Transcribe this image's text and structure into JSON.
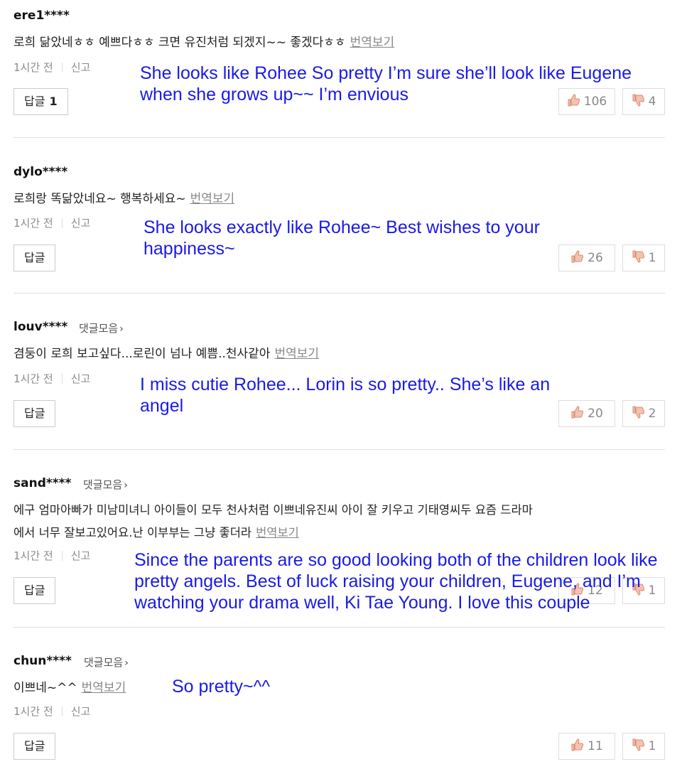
{
  "comments": [
    {
      "user": "ere1****",
      "text": "로희 닮았네ㅎㅎ 예쁘다ㅎㅎ 크면 유진처럼 되겠지~~ 좋겠다ㅎㅎ",
      "translate": "번역보기",
      "time": "1시간 전",
      "report": "신고",
      "reply": "답글",
      "reply_count": "1",
      "likes": "106",
      "dislikes": "4",
      "translation": "She looks like Rohee So pretty I’m sure she’ll look like Eugene when she grows up~~ I’m envious"
    },
    {
      "user": "dylo****",
      "text": "로희랑 똑닮았네요~ 행복하세요~",
      "translate": "번역보기",
      "time": "1시간 전",
      "report": "신고",
      "reply": "답글",
      "likes": "26",
      "dislikes": "1",
      "translation": "She looks exactly like Rohee~ Best wishes to your happiness~"
    },
    {
      "user": "louv****",
      "collect": "댓글모음",
      "text": "겸둥이 로희 보고싶다...로린이 넘나 예쁨..천사같아",
      "translate": "번역보기",
      "time": "1시간 전",
      "report": "신고",
      "reply": "답글",
      "likes": "20",
      "dislikes": "2",
      "translation": "I miss cutie Rohee... Lorin is so pretty.. She’s like an angel"
    },
    {
      "user": "sand****",
      "collect": "댓글모음",
      "text_line1": "에구 엄마아빠가 미남미녀니 아이들이 모두 천사처럼 이쁘네유진씨 아이 잘 키우고 기태영씨두 요즘 드라마",
      "text_line2": "에서 너무 잘보고있어요.난 이부부는 그냥 좋더라",
      "translate": "번역보기",
      "time": "1시간 전",
      "report": "신고",
      "reply": "답글",
      "likes": "12",
      "dislikes": "1",
      "translation": "Since the parents are so good looking both of the children look like pretty angels. Best of luck raising your children, Eugene, and I’m watching your drama well, Ki Tae Young. I love this couple"
    },
    {
      "user": "chun****",
      "collect": "댓글모음",
      "text": "이쁘네~^^",
      "translate": "번역보기",
      "time": "1시간 전",
      "report": "신고",
      "reply": "답글",
      "likes": "11",
      "dislikes": "1",
      "translation": "So pretty~^^"
    }
  ],
  "colors": {
    "translation": "#1a1ae6",
    "thumb_up": "#e8a08a",
    "thumb_down": "#e8a08a"
  },
  "icons": {
    "like": "thumbs-up-icon",
    "dislike": "thumbs-down-icon",
    "collect": "chevron-right-icon"
  }
}
